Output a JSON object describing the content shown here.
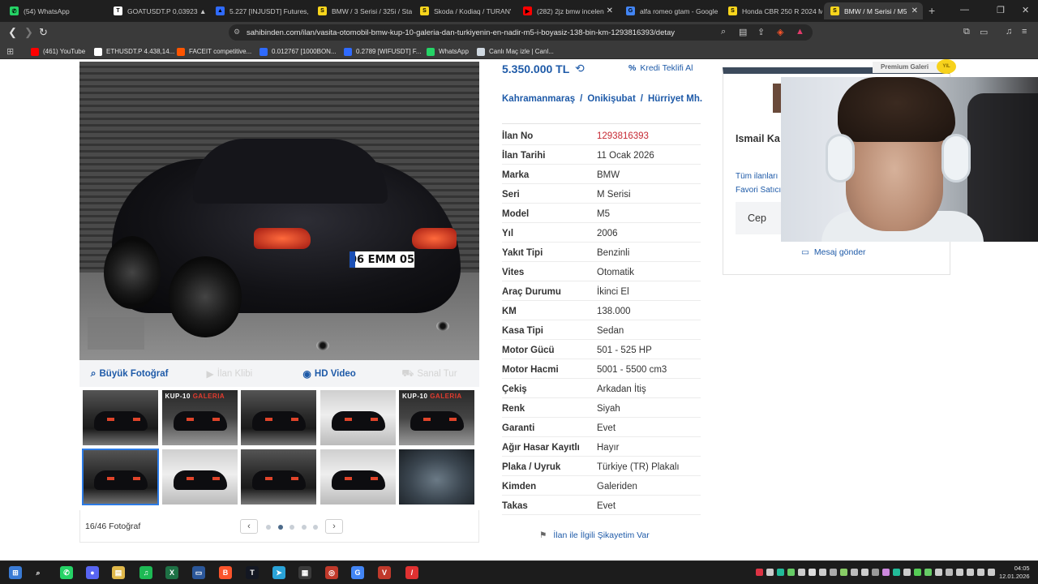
{
  "browser": {
    "tabs": [
      {
        "title": "(54) WhatsApp",
        "color": "#25d366",
        "glyph": "✆"
      },
      {
        "title": "GOATUSDT.P 0,03923 ▲ -",
        "color": "#ffffff",
        "glyph": "T"
      },
      {
        "title": "5.227 [INJUSDT] Futures, U",
        "color": "#2f6bff",
        "glyph": "▲"
      },
      {
        "title": "BMW / 3 Serisi / 325i / Sta",
        "color": "#f8d51c",
        "glyph": "S"
      },
      {
        "title": "Skoda / Kodiaq / TURAN'",
        "color": "#f8d51c",
        "glyph": "S"
      },
      {
        "title": "(282) 2jz bmw incelen",
        "color": "#ff0000",
        "glyph": "▶"
      },
      {
        "title": "alfa romeo gtam - Google",
        "color": "#4285f4",
        "glyph": "G"
      },
      {
        "title": "Honda CBR 250 R 2024 Mo",
        "color": "#f8d51c",
        "glyph": "S"
      },
      {
        "title": "BMW / M Serisi / M5",
        "color": "#f8d51c",
        "glyph": "S"
      }
    ],
    "url": "sahibinden.com/ilan/vasita-otomobil-bmw-kup-10-galeria-dan-turkiyenin-en-nadir-m5-i-boyasiz-138-bin-km-1293816393/detay",
    "bookmarks": [
      {
        "label": "(461) YouTube",
        "color": "#ff0000"
      },
      {
        "label": "ETHUSDT.P 4.438,14...",
        "color": "#ffffff"
      },
      {
        "label": "FACEIT competitive...",
        "color": "#ff5500"
      },
      {
        "label": "0.012767 [1000BON...",
        "color": "#2f6bff"
      },
      {
        "label": "0.2789 [WIFUSDT] F...",
        "color": "#2f6bff"
      },
      {
        "label": "WhatsApp",
        "color": "#25d366"
      },
      {
        "label": "Canlı Maç izle | Canl...",
        "color": "#cfd8e0"
      }
    ]
  },
  "listing": {
    "price": "5.350.000 TL",
    "credit_link": "Kredi Teklifi Al",
    "location": [
      "Kahramanmaraş",
      "Onikişubat",
      "Hürriyet Mh."
    ],
    "location_sep": "/",
    "plate_text": "06 EMM 05",
    "specs": [
      {
        "key": "İlan No",
        "value": "1293816393",
        "highlight": true
      },
      {
        "key": "İlan Tarihi",
        "value": "11 Ocak 2026"
      },
      {
        "key": "Marka",
        "value": "BMW"
      },
      {
        "key": "Seri",
        "value": "M Serisi"
      },
      {
        "key": "Model",
        "value": "M5"
      },
      {
        "key": "Yıl",
        "value": "2006"
      },
      {
        "key": "Yakıt Tipi",
        "value": "Benzinli"
      },
      {
        "key": "Vites",
        "value": "Otomatik"
      },
      {
        "key": "Araç Durumu",
        "value": "İkinci El"
      },
      {
        "key": "KM",
        "value": "138.000"
      },
      {
        "key": "Kasa Tipi",
        "value": "Sedan"
      },
      {
        "key": "Motor Gücü",
        "value": "501 - 525 HP"
      },
      {
        "key": "Motor Hacmi",
        "value": "5001 - 5500 cm3"
      },
      {
        "key": "Çekiş",
        "value": "Arkadan İtiş"
      },
      {
        "key": "Renk",
        "value": "Siyah"
      },
      {
        "key": "Garanti",
        "value": "Evet"
      },
      {
        "key": "Ağır Hasar Kayıtlı",
        "value": "Hayır"
      },
      {
        "key": "Plaka / Uyruk",
        "value": "Türkiye (TR) Plakalı"
      },
      {
        "key": "Kimden",
        "value": "Galeriden"
      },
      {
        "key": "Takas",
        "value": "Evet"
      }
    ],
    "complaint": "İlan ile İlgili Şikayetim Var"
  },
  "gallery": {
    "tabs": [
      {
        "label": "Büyük Fotoğraf",
        "icon": "magnifier-icon",
        "enabled": true
      },
      {
        "label": "İlan Klibi",
        "icon": "video-camera-icon",
        "enabled": false
      },
      {
        "label": "HD Video",
        "icon": "play-circle-icon",
        "enabled": true
      },
      {
        "label": "Sanal Tur",
        "icon": "car-icon",
        "enabled": false
      }
    ],
    "counter": "16/46 Fotoğraf",
    "banner_text_1": "KUP-10",
    "banner_text_2": "GALERIA",
    "thumbs": [
      {
        "style": "dark",
        "selected": false,
        "banner": false
      },
      {
        "style": "gal",
        "selected": false,
        "banner": true
      },
      {
        "style": "dark",
        "selected": false,
        "banner": false
      },
      {
        "style": "light",
        "selected": false,
        "banner": false
      },
      {
        "style": "gal",
        "selected": false,
        "banner": true
      },
      {
        "style": "dark",
        "selected": true,
        "banner": false
      },
      {
        "style": "light",
        "selected": false,
        "banner": false
      },
      {
        "style": "dark",
        "selected": false,
        "banner": false
      },
      {
        "style": "light",
        "selected": false,
        "banner": false
      },
      {
        "style": "engine",
        "selected": false,
        "banner": false
      }
    ],
    "pages": 5,
    "current_page": 2
  },
  "seller": {
    "badge": "Premium Galeri",
    "year_badge": "YIL",
    "name": "Ismail Ka",
    "links": [
      "Tüm ilanları",
      "Favori Satıcı"
    ],
    "phone_label": "Cep",
    "message": "Mesaj gönder"
  },
  "taskbar": {
    "time": "04:05",
    "date": "12.01.2026",
    "apps": [
      {
        "glyph": "⊞",
        "color": "#3a7bd5"
      },
      {
        "glyph": "⌕",
        "color": "#1c1c1c"
      },
      {
        "glyph": "✆",
        "color": "#25d366"
      },
      {
        "glyph": "●",
        "color": "#5865f2"
      },
      {
        "glyph": "▤",
        "color": "#e0b84a"
      },
      {
        "glyph": "♫",
        "color": "#1db954"
      },
      {
        "glyph": "X",
        "color": "#1e7145"
      },
      {
        "glyph": "▭",
        "color": "#2b579a"
      },
      {
        "glyph": "B",
        "color": "#fb542b"
      },
      {
        "glyph": "T",
        "color": "#131722"
      },
      {
        "glyph": "➤",
        "color": "#2aa3d8"
      },
      {
        "glyph": "▦",
        "color": "#3a3a3a"
      },
      {
        "glyph": "◎",
        "color": "#c0392b"
      },
      {
        "glyph": "G",
        "color": "#4285f4"
      },
      {
        "glyph": "V",
        "color": "#c0392b"
      },
      {
        "glyph": "/",
        "color": "#e03131"
      }
    ]
  }
}
